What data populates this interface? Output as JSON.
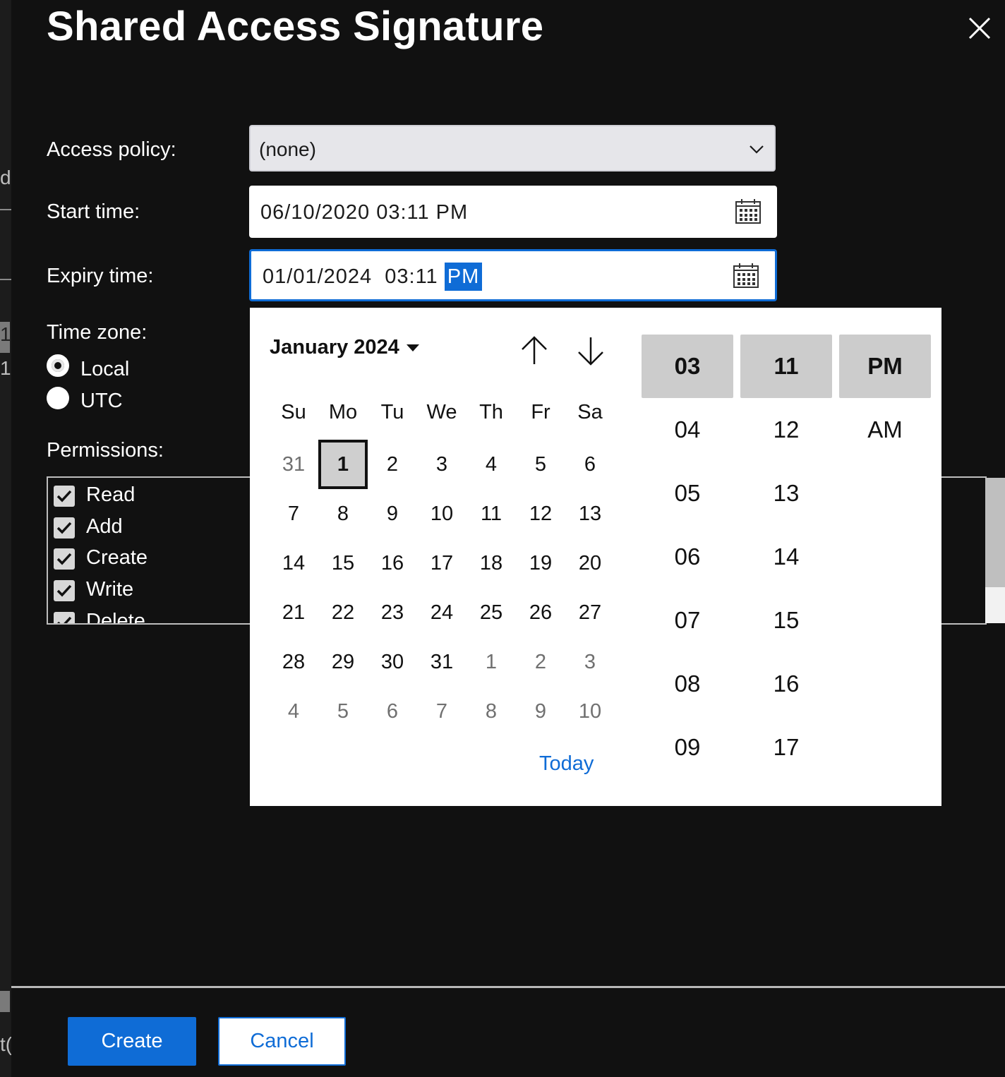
{
  "dialog": {
    "title": "Shared Access Signature"
  },
  "form": {
    "access_policy_label": "Access policy:",
    "access_policy_value": "(none)",
    "start_time_label": "Start time:",
    "start_time_value": "06/10/2020  03:11  PM",
    "expiry_time_label": "Expiry time:",
    "expiry_time_value_main": "01/01/2024  03:11 ",
    "expiry_time_value_selected": "PM",
    "time_zone_label": "Time zone:",
    "time_zone_options": [
      {
        "label": "Local",
        "selected": true
      },
      {
        "label": "UTC",
        "selected": false
      }
    ],
    "permissions_label": "Permissions:",
    "permissions": [
      {
        "label": "Read",
        "checked": true
      },
      {
        "label": "Add",
        "checked": true
      },
      {
        "label": "Create",
        "checked": true
      },
      {
        "label": "Write",
        "checked": true
      },
      {
        "label": "Delete",
        "checked": true
      }
    ]
  },
  "calendar": {
    "month_title": "January 2024",
    "weekdays": [
      "Su",
      "Mo",
      "Tu",
      "We",
      "Th",
      "Fr",
      "Sa"
    ],
    "weeks": [
      [
        "31",
        "1",
        "2",
        "3",
        "4",
        "5",
        "6"
      ],
      [
        "7",
        "8",
        "9",
        "10",
        "11",
        "12",
        "13"
      ],
      [
        "14",
        "15",
        "16",
        "17",
        "18",
        "19",
        "20"
      ],
      [
        "21",
        "22",
        "23",
        "24",
        "25",
        "26",
        "27"
      ],
      [
        "28",
        "29",
        "30",
        "31",
        "1",
        "2",
        "3"
      ],
      [
        "4",
        "5",
        "6",
        "7",
        "8",
        "9",
        "10"
      ]
    ],
    "selected_day": "1",
    "today_label": "Today"
  },
  "time_picker": {
    "hours": [
      "03",
      "04",
      "05",
      "06",
      "07",
      "08",
      "09"
    ],
    "minutes": [
      "11",
      "12",
      "13",
      "14",
      "15",
      "16",
      "17"
    ],
    "periods": [
      "PM",
      "AM"
    ],
    "selected": {
      "hour": "03",
      "minute": "11",
      "period": "PM"
    }
  },
  "footer": {
    "create_label": "Create",
    "cancel_label": "Cancel"
  },
  "left_peek": {
    "texts": [
      "d",
      "1",
      "1",
      "t("
    ]
  },
  "colors": {
    "accent": "#0f6cd6",
    "background": "#111111",
    "popup": "#ffffff"
  }
}
